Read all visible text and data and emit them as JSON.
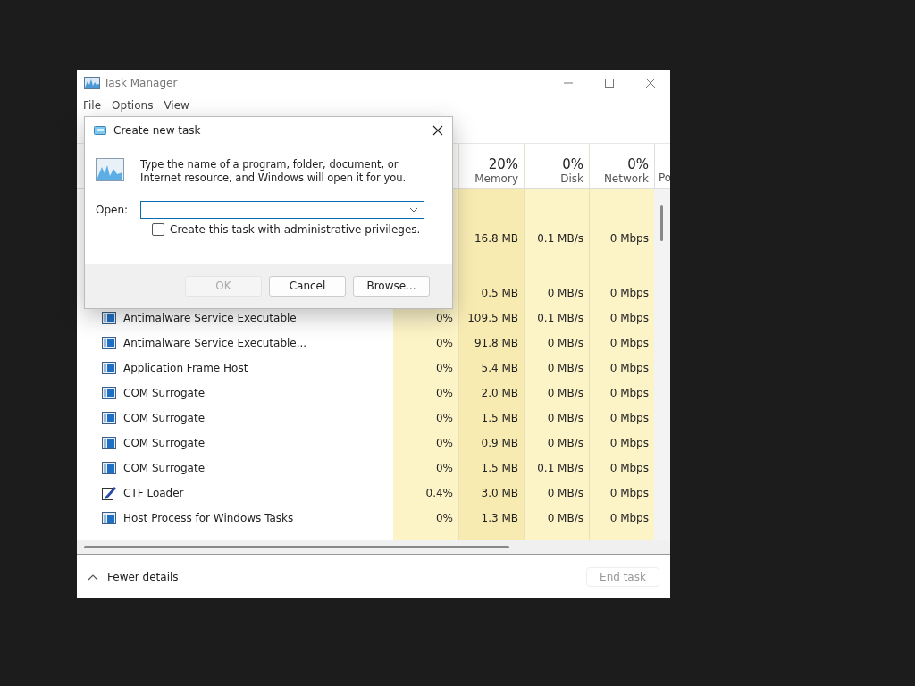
{
  "window": {
    "title": "Task Manager",
    "menu": [
      "File",
      "Options",
      "View"
    ]
  },
  "table": {
    "columns": [
      {
        "percent": "20%",
        "label": "Memory"
      },
      {
        "percent": "0%",
        "label": "Disk"
      },
      {
        "percent": "0%",
        "label": "Network"
      },
      {
        "label": "Po"
      }
    ],
    "rows": [
      {
        "kind": "group"
      },
      {
        "kind": "covered",
        "memory": "16.8 MB",
        "disk": "0.1 MB/s",
        "network": "0 Mbps"
      },
      {
        "kind": "group"
      },
      {
        "kind": "covered",
        "memory": "0.5 MB",
        "disk": "0 MB/s",
        "network": "0 Mbps"
      },
      {
        "kind": "process",
        "name": "Antimalware Service Executable",
        "cpu": "0%",
        "memory": "109.5 MB",
        "disk": "0.1 MB/s",
        "network": "0 Mbps"
      },
      {
        "kind": "process",
        "name": "Antimalware Service Executable...",
        "cpu": "0%",
        "memory": "91.8 MB",
        "disk": "0 MB/s",
        "network": "0 Mbps"
      },
      {
        "kind": "process",
        "name": "Application Frame Host",
        "cpu": "0%",
        "memory": "5.4 MB",
        "disk": "0 MB/s",
        "network": "0 Mbps"
      },
      {
        "kind": "process",
        "name": "COM Surrogate",
        "cpu": "0%",
        "memory": "2.0 MB",
        "disk": "0 MB/s",
        "network": "0 Mbps"
      },
      {
        "kind": "process",
        "name": "COM Surrogate",
        "cpu": "0%",
        "memory": "1.5 MB",
        "disk": "0 MB/s",
        "network": "0 Mbps"
      },
      {
        "kind": "process",
        "name": "COM Surrogate",
        "cpu": "0%",
        "memory": "0.9 MB",
        "disk": "0 MB/s",
        "network": "0 Mbps"
      },
      {
        "kind": "process",
        "name": "COM Surrogate",
        "cpu": "0%",
        "memory": "1.5 MB",
        "disk": "0.1 MB/s",
        "network": "0 Mbps"
      },
      {
        "kind": "pen",
        "name": "CTF Loader",
        "cpu": "0.4%",
        "memory": "3.0 MB",
        "disk": "0 MB/s",
        "network": "0 Mbps"
      },
      {
        "kind": "process",
        "name": "Host Process for Windows Tasks",
        "cpu": "0%",
        "memory": "1.3 MB",
        "disk": "0 MB/s",
        "network": "0 Mbps"
      }
    ]
  },
  "footer": {
    "toggle": "Fewer details",
    "end_task": {
      "label": "End task",
      "disabled": true
    }
  },
  "dialog": {
    "title": "Create new task",
    "message": "Type the name of a program, folder, document, or Internet resource, and Windows will open it for you.",
    "open_label": "Open:",
    "admin_checkbox": {
      "label": "Create this task with administrative privileges.",
      "checked": false
    },
    "buttons": [
      {
        "label": "OK",
        "disabled": true
      },
      {
        "label": "Cancel",
        "disabled": false
      },
      {
        "label": "Browse...",
        "disabled": false
      }
    ]
  }
}
